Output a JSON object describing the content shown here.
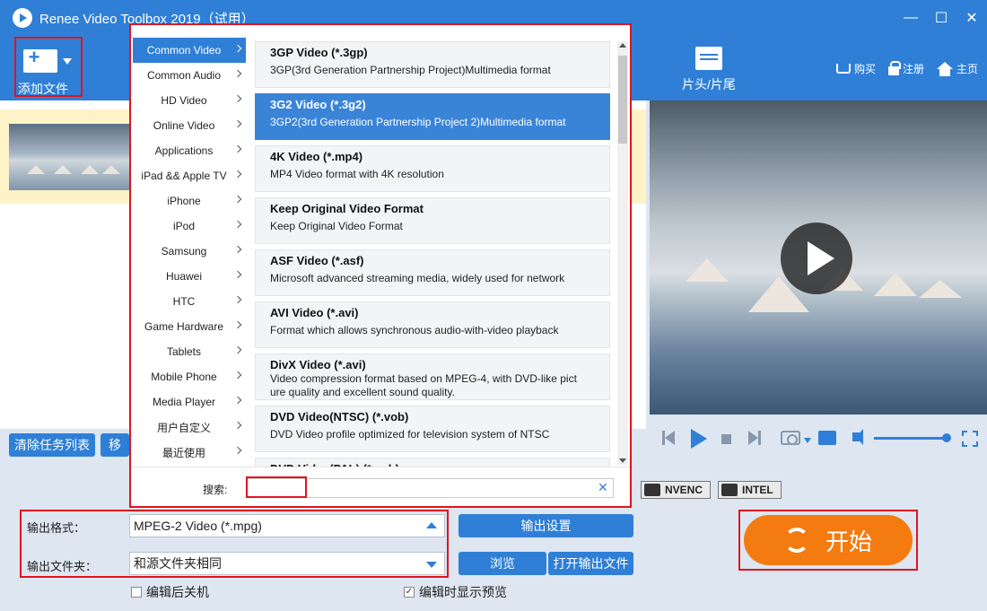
{
  "window": {
    "title": "Renee Video Toolbox 2019（试用）",
    "minimize": "—",
    "maximize": "☐",
    "close": "✕"
  },
  "toolbar": {
    "add_file_label": "添加文件",
    "intro_outro_label": "片头/片尾",
    "links": {
      "buy": "购买",
      "register": "注册",
      "home": "主页"
    }
  },
  "task_bar": {
    "clear_list": "清除任务列表",
    "move": "移"
  },
  "encoders": {
    "nvenc": "NVENC",
    "intel": "INTEL"
  },
  "output": {
    "format_label": "输出格式：",
    "format_value": "MPEG-2 Video (*.mpg)",
    "folder_label": "输出文件夹：",
    "folder_value": "和源文件夹相同",
    "settings_button": "输出设置",
    "browse_button": "浏览",
    "open_folder_button": "打开输出文件",
    "shutdown_after": "编辑后关机",
    "show_preview": "编辑时显示预览",
    "show_preview_checked": true,
    "shutdown_checked": false
  },
  "start_button": "开始",
  "format_popup": {
    "categories": [
      "Common Video",
      "Common Audio",
      "HD Video",
      "Online Video",
      "Applications",
      "iPad && Apple TV",
      "iPhone",
      "iPod",
      "Samsung",
      "Huawei",
      "HTC",
      "Game Hardware",
      "Tablets",
      "Mobile Phone",
      "Media Player",
      "用户自定义",
      "最近使用"
    ],
    "active_category": "Common Video",
    "formats": [
      {
        "title": "3GP Video (*.3gp)",
        "desc": "3GP(3rd Generation Partnership Project)Multimedia format"
      },
      {
        "title": "3G2 Video (*.3g2)",
        "desc": "3GP2(3rd Generation Partnership Project 2)Multimedia format"
      },
      {
        "title": "4K Video (*.mp4)",
        "desc": "MP4 Video format with 4K resolution"
      },
      {
        "title": "Keep Original Video Format",
        "desc": "Keep Original Video Format"
      },
      {
        "title": "ASF Video (*.asf)",
        "desc": "Microsoft advanced streaming media, widely used for network"
      },
      {
        "title": "AVI Video (*.avi)",
        "desc": "Format which allows synchronous audio-with-video playback"
      },
      {
        "title": "DivX Video (*.avi)",
        "desc": "Video compression format based on MPEG-4, with DVD-like pict ure quality and excellent sound quality."
      },
      {
        "title": "DVD Video(NTSC) (*.vob)",
        "desc": "DVD Video profile optimized for television system of NTSC"
      },
      {
        "title": "DVD Video(PAL) (*.vob)",
        "desc": ""
      }
    ],
    "selected_index": 1,
    "search_label": "搜索:",
    "search_value": ""
  }
}
